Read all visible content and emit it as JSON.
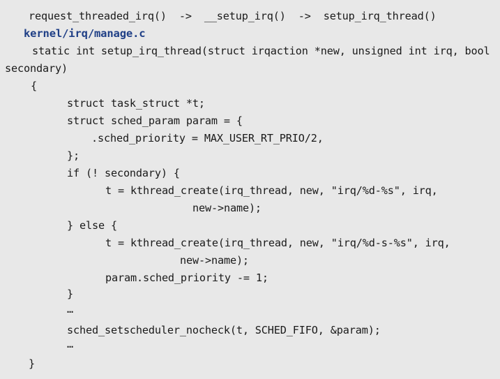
{
  "call_chain": "request_threaded_irq()  ->  __setup_irq()  ->  setup_irq_thread()",
  "file_path": "kernel/irq/manage.c",
  "code": {
    "signature": "static int setup_irq_thread(struct irqaction *new, unsigned int irq, bool",
    "signature_cont": "secondary)",
    "open_brace": "{",
    "decl_task": "struct task_struct *t;",
    "decl_param": "struct sched_param param = {",
    "priority_init": ".sched_priority = MAX_USER_RT_PRIO/2,",
    "close_init": "};",
    "if_line": "if (! secondary) {",
    "create_1": "t = kthread_create(irq_thread, new, \"irq/%d-%s\", irq,",
    "create_1_cont": "new->name);",
    "else_line": "} else {",
    "create_2": "t = kthread_create(irq_thread, new, \"irq/%d-s-%s\", irq,",
    "create_2_cont": "new->name);",
    "priority_dec": "param.sched_priority -= 1;",
    "close_if": "}",
    "ellipsis_1": "…",
    "setscheduler": "sched_setscheduler_nocheck(t, SCHED_FIFO, &param);",
    "ellipsis_2": "…",
    "close_brace": "}"
  }
}
